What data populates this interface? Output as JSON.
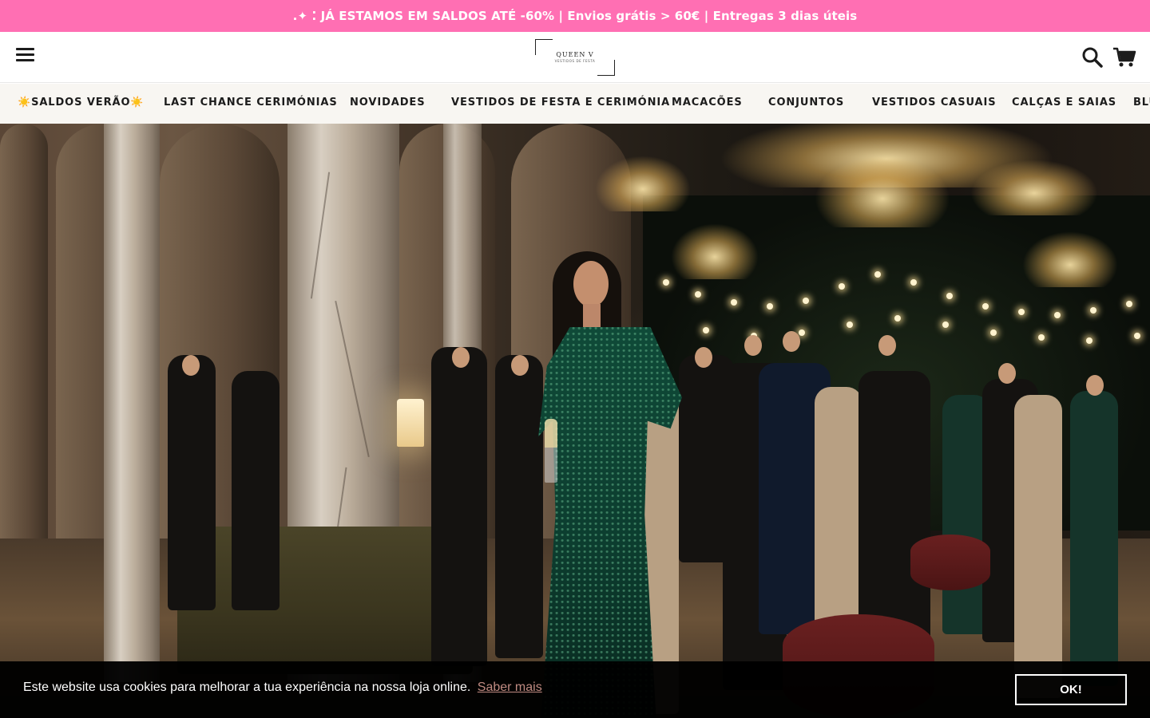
{
  "announcement": {
    "text": ".✦ ⁚ JÁ ESTAMOS EM SALDOS ATÉ -60% | Envios grátis > 60€ | Entregas 3 dias úteis",
    "background_color": "#ff6fb3"
  },
  "header": {
    "logo_name": "QUEEN V",
    "logo_tagline": "VESTIDOS DE FESTA",
    "menu_icon": "hamburger-menu-icon",
    "search_icon": "search-icon",
    "cart_icon": "shopping-cart-icon"
  },
  "nav": {
    "items": [
      {
        "label": "☀️SALDOS VERÃO☀️"
      },
      {
        "label": "LAST CHANCE CERIMÓNIAS"
      },
      {
        "label": "NOVIDADES"
      },
      {
        "label": "VESTIDOS DE FESTA E CERIMÓNIA"
      },
      {
        "label": "MACACÕES"
      },
      {
        "label": "CONJUNTOS"
      },
      {
        "label": "VESTIDOS CASUAIS"
      },
      {
        "label": "CALÇAS E SAIAS"
      },
      {
        "label": "BLU"
      }
    ]
  },
  "hero": {
    "image_name": "hero-banner-image"
  },
  "cookie_banner": {
    "message": "Este website usa cookies para melhorar a tua experiência na nossa loja online.",
    "link_label": "Saber mais",
    "button_label": "OK!",
    "link_color": "#c08b82"
  }
}
